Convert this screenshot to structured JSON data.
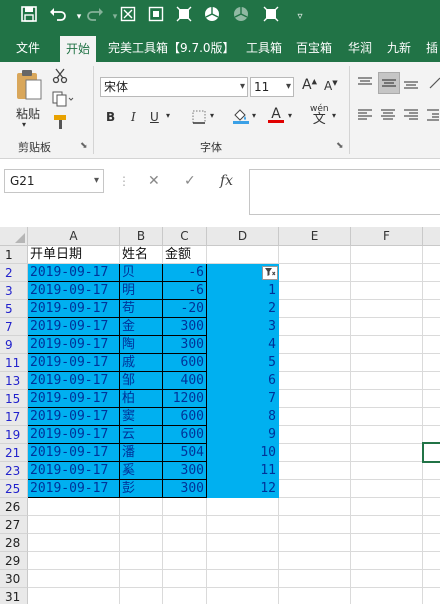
{
  "qat": {
    "icons": [
      "save-icon",
      "undo-icon",
      "redo-icon",
      "clear-format-icon",
      "screenshot-icon",
      "fullscreen-icon",
      "pie-icon",
      "pie-dim-icon",
      "crop-icon",
      "customize-icon"
    ]
  },
  "tabs": [
    "文件",
    "开始",
    "完美工具箱【9.7.0版】",
    "工具箱",
    "百宝箱",
    "华润",
    "九新",
    "插"
  ],
  "ribbon": {
    "paste_label": "粘贴",
    "clipboard_label": "剪贴板",
    "font_name": "宋体",
    "font_size": "11",
    "font_label": "字体",
    "bold": "B",
    "italic": "I",
    "underline": "U",
    "font_color_letter": "A",
    "phonetic": "wén",
    "grow_font": "A",
    "shrink_font": "A"
  },
  "formula_bar": {
    "name_box": "G21",
    "cancel": "✕",
    "enter": "✓",
    "fx": "fx",
    "value": ""
  },
  "sheet": {
    "columns": [
      "A",
      "B",
      "C",
      "D",
      "E",
      "F"
    ],
    "header_row": {
      "row": "1",
      "a": "开单日期",
      "b": "姓名",
      "c": "金额"
    },
    "rows": [
      {
        "row": "2",
        "a": "2019-09-17",
        "b": "贝",
        "c": "-6",
        "d": ""
      },
      {
        "row": "3",
        "a": "2019-09-17",
        "b": "明",
        "c": "-6",
        "d": "1"
      },
      {
        "row": "5",
        "a": "2019-09-17",
        "b": "苟",
        "c": "-20",
        "d": "2"
      },
      {
        "row": "7",
        "a": "2019-09-17",
        "b": "金",
        "c": "300",
        "d": "3"
      },
      {
        "row": "9",
        "a": "2019-09-17",
        "b": "陶",
        "c": "300",
        "d": "4"
      },
      {
        "row": "11",
        "a": "2019-09-17",
        "b": "戚",
        "c": "600",
        "d": "5"
      },
      {
        "row": "13",
        "a": "2019-09-17",
        "b": "邹",
        "c": "400",
        "d": "6"
      },
      {
        "row": "15",
        "a": "2019-09-17",
        "b": "柏",
        "c": "1200",
        "d": "7"
      },
      {
        "row": "17",
        "a": "2019-09-17",
        "b": "窦",
        "c": "600",
        "d": "8"
      },
      {
        "row": "19",
        "a": "2019-09-17",
        "b": "云",
        "c": "600",
        "d": "9"
      },
      {
        "row": "21",
        "a": "2019-09-17",
        "b": "潘",
        "c": "504",
        "d": "10"
      },
      {
        "row": "23",
        "a": "2019-09-17",
        "b": "奚",
        "c": "300",
        "d": "11"
      },
      {
        "row": "25",
        "a": "2019-09-17",
        "b": "彭",
        "c": "300",
        "d": "12"
      }
    ],
    "empty_rows": [
      "26",
      "27",
      "28",
      "29",
      "30",
      "31"
    ],
    "filter_icon": "filter-active-icon",
    "colors": {
      "fill": "#00b0f0",
      "brand": "#217346"
    }
  }
}
